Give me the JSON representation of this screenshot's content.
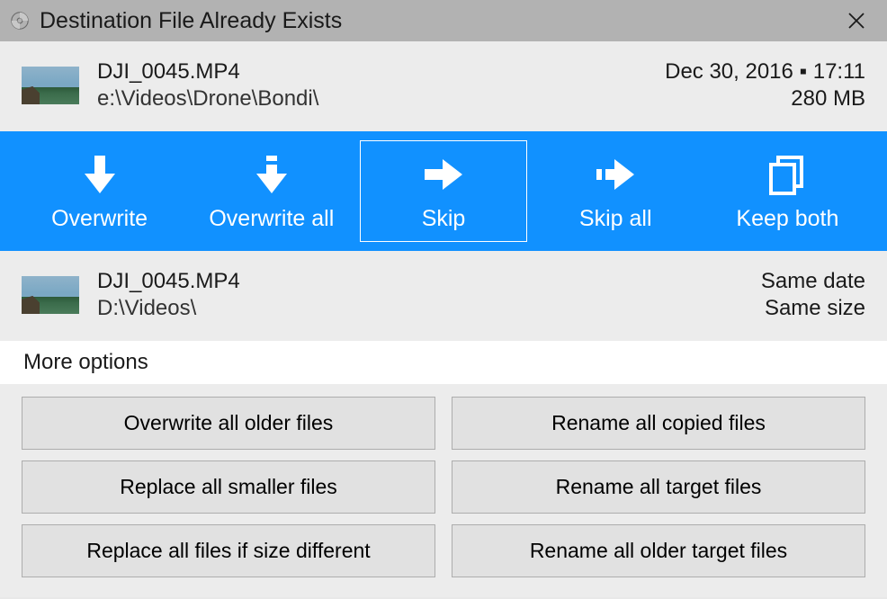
{
  "title": "Destination File Already Exists",
  "source": {
    "name": "DJI_0045.MP4",
    "path": "e:\\Videos\\Drone\\Bondi\\",
    "date": "Dec 30, 2016 ▪ 17:11",
    "size": "280 MB"
  },
  "dest": {
    "name": "DJI_0045.MP4",
    "path": "D:\\Videos\\",
    "date": "Same date",
    "size": "Same size"
  },
  "actions": {
    "overwrite": "Overwrite",
    "overwrite_all": "Overwrite all",
    "skip": "Skip",
    "skip_all": "Skip all",
    "keep_both": "Keep both"
  },
  "more_label": "More options",
  "more": {
    "overwrite_older": "Overwrite all older files",
    "rename_copied": "Rename all copied files",
    "replace_smaller": "Replace all smaller files",
    "rename_target": "Rename all target files",
    "replace_diff": "Replace all files if size different",
    "rename_older_target": "Rename all older target files"
  }
}
